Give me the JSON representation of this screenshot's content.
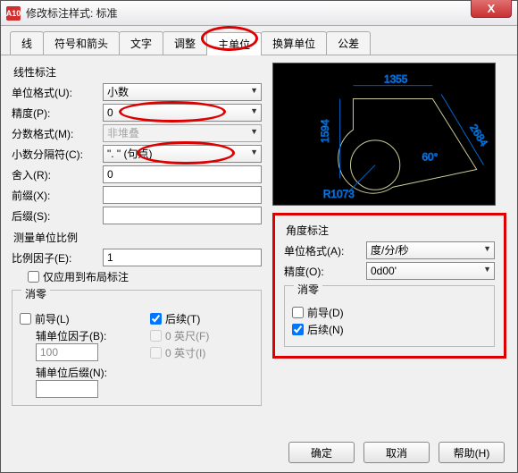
{
  "window": {
    "title": "修改标注样式: 标准",
    "app_icon": "A10",
    "close": "X"
  },
  "tabs": [
    "线",
    "符号和箭头",
    "文字",
    "调整",
    "主单位",
    "换算单位",
    "公差"
  ],
  "active_tab": 4,
  "linear": {
    "section": "线性标注",
    "unit_format_lbl": "单位格式(U):",
    "unit_format_val": "小数",
    "precision_lbl": "精度(P):",
    "precision_val": "0",
    "fraction_lbl": "分数格式(M):",
    "fraction_val": "非堆叠",
    "decimal_sep_lbl": "小数分隔符(C):",
    "decimal_sep_val": "\". \" (句点)",
    "round_lbl": "舍入(R):",
    "round_val": "0",
    "prefix_lbl": "前缀(X):",
    "prefix_val": "",
    "suffix_lbl": "后缀(S):",
    "suffix_val": ""
  },
  "scale": {
    "section": "测量单位比例",
    "factor_lbl": "比例因子(E):",
    "factor_val": "1",
    "apply_layout_lbl": "仅应用到布局标注"
  },
  "zero": {
    "section": "消零",
    "leading_lbl": "前导(L)",
    "trailing_lbl": "后续(T)",
    "trailing_checked": true,
    "aux_factor_lbl": "辅单位因子(B):",
    "aux_factor_val": "100",
    "aux_suffix_lbl": "辅单位后缀(N):",
    "aux_suffix_val": "",
    "feet_lbl": "0 英尺(F)",
    "inch_lbl": "0 英寸(I)"
  },
  "angle": {
    "section": "角度标注",
    "unit_format_lbl": "单位格式(A):",
    "unit_format_val": "度/分/秒",
    "precision_lbl": "精度(O):",
    "precision_val": "0d00'",
    "zero_section": "消零",
    "leading_lbl": "前导(D)",
    "trailing_lbl": "后续(N)",
    "trailing_checked": true
  },
  "preview": {
    "dim1": "1355",
    "dim2": "1594",
    "dim3": "2684",
    "ang": "60°",
    "rad": "R1073"
  },
  "buttons": {
    "ok": "确定",
    "cancel": "取消",
    "help": "帮助(H)"
  }
}
